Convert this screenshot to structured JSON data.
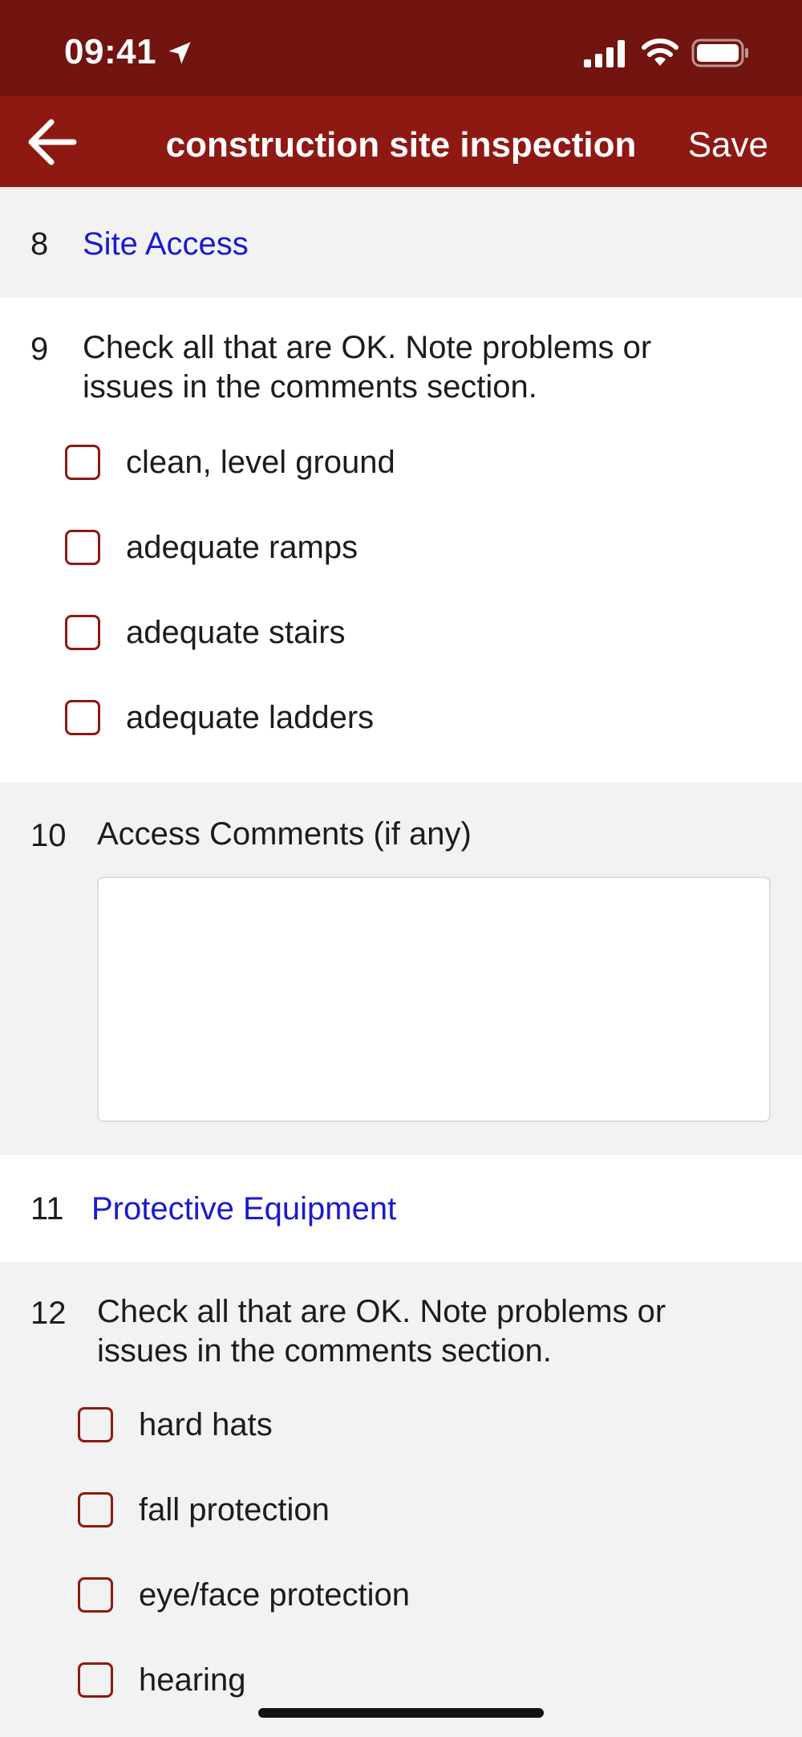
{
  "status_bar": {
    "time": "09:41",
    "icons": [
      "location-arrow-icon",
      "cellular-signal-icon",
      "wifi-icon",
      "battery-icon"
    ]
  },
  "nav": {
    "title": "construction site inspection",
    "save_label": "Save",
    "back_icon": "arrow-left-icon"
  },
  "colors": {
    "status_bar_bg": "#72140f",
    "nav_bg": "#8e1913",
    "heading_link": "#1a1ad0",
    "checkbox_border": "#8e1913",
    "section_gray": "#f2f2f2",
    "section_white": "#ffffff"
  },
  "form": {
    "q8": {
      "number": "8",
      "heading": "Site Access"
    },
    "q9": {
      "number": "9",
      "text_line1": "Check all that are OK.  Note problems or",
      "text_line2": "issues in the comments section.",
      "options": [
        {
          "label": "clean, level ground",
          "checked": false
        },
        {
          "label": "adequate ramps",
          "checked": false
        },
        {
          "label": "adequate stairs",
          "checked": false
        },
        {
          "label": "adequate ladders",
          "checked": false
        }
      ]
    },
    "q10": {
      "number": "10",
      "label": "Access Comments (if any)",
      "value": ""
    },
    "q11": {
      "number": "11",
      "heading": "Protective Equipment"
    },
    "q12": {
      "number": "12",
      "text_line1": "Check all that are OK.  Note problems or",
      "text_line2": "issues in the comments section.",
      "options": [
        {
          "label": "hard hats",
          "checked": false
        },
        {
          "label": "fall protection",
          "checked": false
        },
        {
          "label": "eye/face protection",
          "checked": false
        },
        {
          "label": "hearing",
          "checked": false
        }
      ]
    }
  }
}
